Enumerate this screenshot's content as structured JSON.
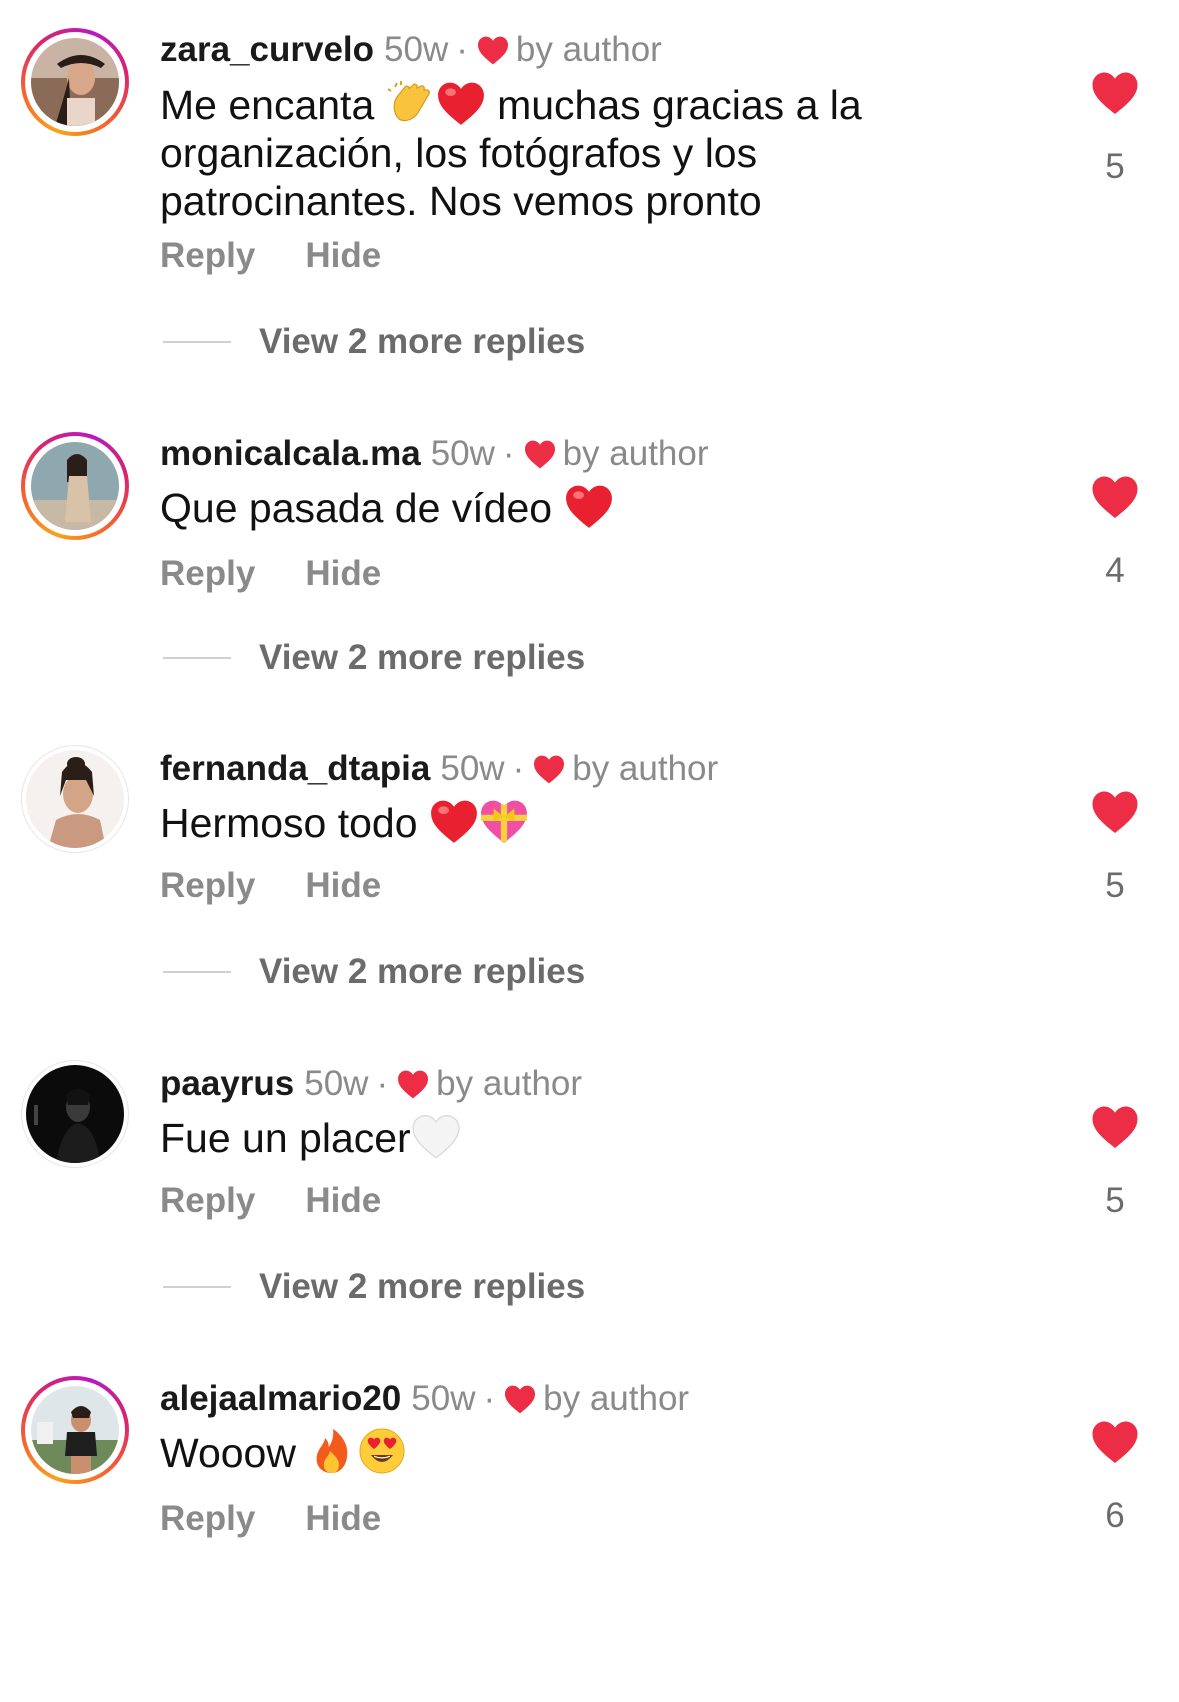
{
  "comments": [
    {
      "username": "zara_curvelo",
      "time": "50w",
      "dot": "·",
      "by_author": "by author",
      "text_parts": [
        "Me encanta",
        "muchas gracias a la organización, los fotógrafos y los patrocinantes. Nos vemos pronto"
      ],
      "emojis": [
        "clapping-hands",
        "red-heart"
      ],
      "reply_label": "Reply",
      "hide_label": "Hide",
      "view_more": "View 2 more replies",
      "likes": "5",
      "story_ring": true
    },
    {
      "username": "monicalcala.ma",
      "time": "50w",
      "dot": "·",
      "by_author": "by author",
      "text_parts": [
        "Que pasada de vídeo"
      ],
      "emojis": [
        "red-heart"
      ],
      "reply_label": "Reply",
      "hide_label": "Hide",
      "view_more": "View 2 more replies",
      "likes": "4",
      "story_ring": true
    },
    {
      "username": "fernanda_dtapia",
      "time": "50w",
      "dot": "·",
      "by_author": "by author",
      "text_parts": [
        "Hermoso todo"
      ],
      "emojis": [
        "red-heart",
        "heart-with-ribbon"
      ],
      "reply_label": "Reply",
      "hide_label": "Hide",
      "view_more": "View 2 more replies",
      "likes": "5",
      "story_ring": false
    },
    {
      "username": "paayrus",
      "time": "50w",
      "dot": "·",
      "by_author": "by author",
      "text_parts": [
        "Fue un placer"
      ],
      "emojis": [
        "white-heart"
      ],
      "reply_label": "Reply",
      "hide_label": "Hide",
      "view_more": "View 2 more replies",
      "likes": "5",
      "story_ring": false
    },
    {
      "username": "alejaalmario20",
      "time": "50w",
      "dot": "·",
      "by_author": "by author",
      "text_parts": [
        "Wooow"
      ],
      "emojis": [
        "fire",
        "heart-eyes-face"
      ],
      "reply_label": "Reply",
      "hide_label": "Hide",
      "likes": "6",
      "story_ring": true
    }
  ],
  "colors": {
    "like_red": "#ed2c45",
    "secondary_text": "#8a8a8a",
    "primary_text": "#111111"
  }
}
